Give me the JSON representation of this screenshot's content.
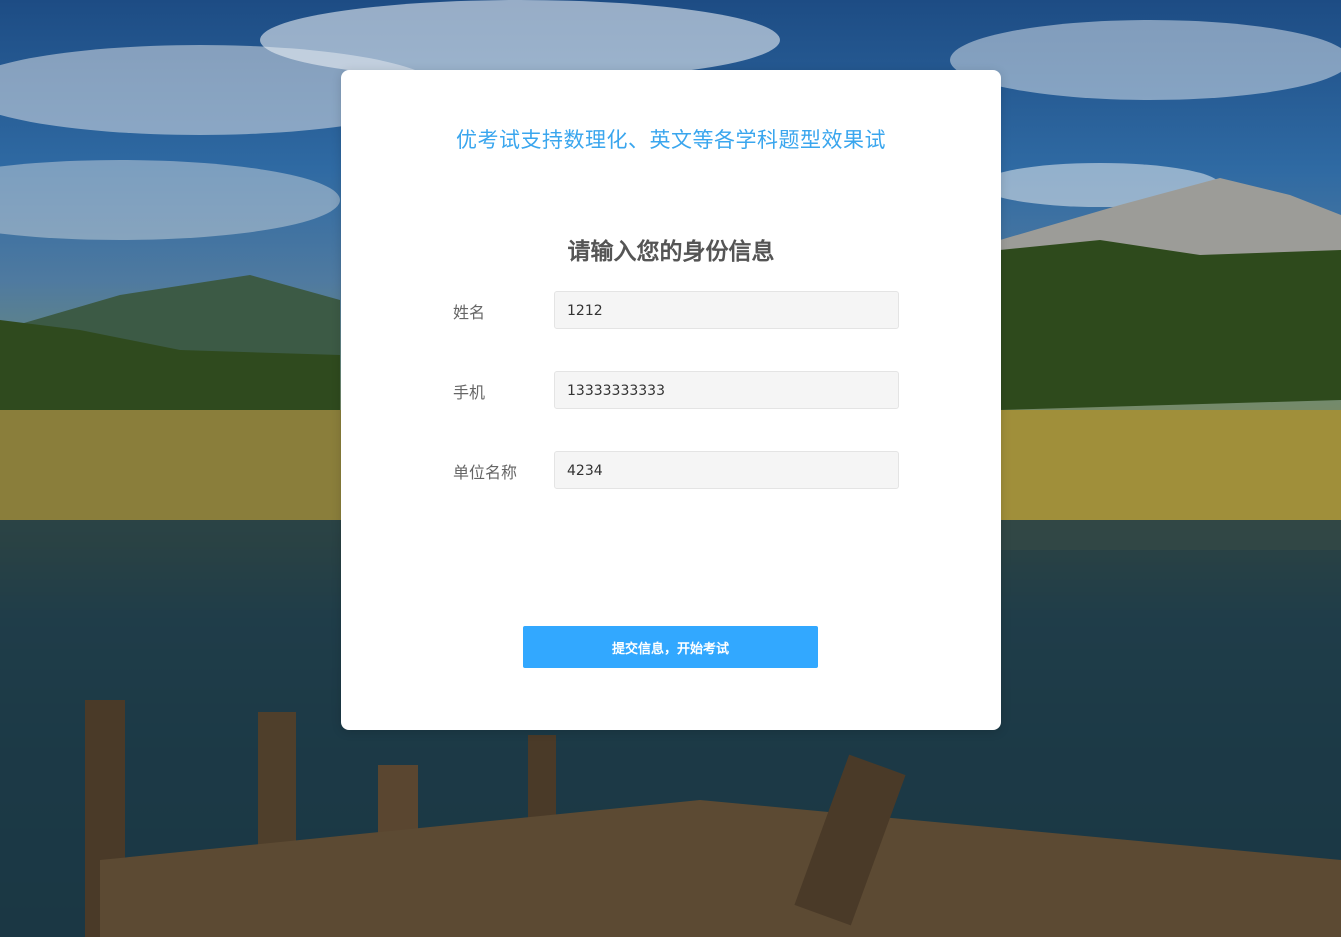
{
  "page": {
    "subtitle": "优考试支持数理化、英文等各学科题型效果试",
    "heading": "请输入您的身份信息",
    "accent_color": "#3aa6ee",
    "button_color": "#32a8ff"
  },
  "form": {
    "fields": [
      {
        "label": "姓名",
        "value": "1212"
      },
      {
        "label": "手机",
        "value": "13333333333"
      },
      {
        "label": "单位名称",
        "value": "4234"
      }
    ],
    "submit_label": "提交信息，开始考试"
  },
  "background": {
    "description_icon": "landscape-lake-mountains"
  }
}
